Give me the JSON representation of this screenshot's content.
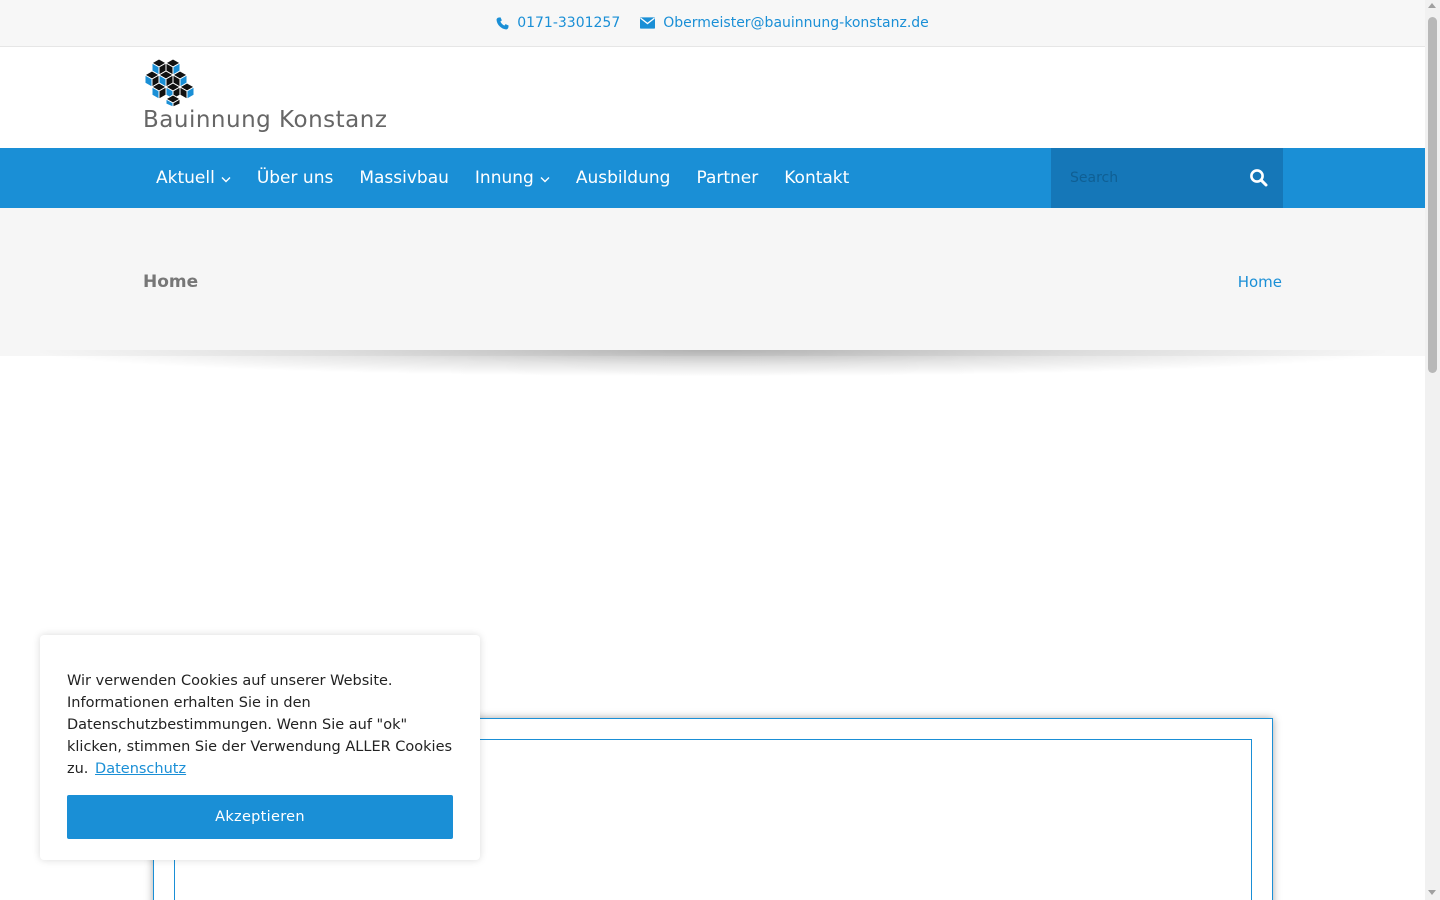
{
  "topbar": {
    "phone": "0171-3301257",
    "phone_icon": "phone-icon",
    "email": "Obermeister@bauinnung-konstanz.de",
    "email_icon": "envelope-icon"
  },
  "header": {
    "logo_icon": "cubes-logo",
    "site_title": "Bauinnung Konstanz"
  },
  "nav": {
    "items": [
      {
        "label": "Aktuell",
        "has_dropdown": true
      },
      {
        "label": "Über uns",
        "has_dropdown": false
      },
      {
        "label": "Massivbau",
        "has_dropdown": false
      },
      {
        "label": "Innung",
        "has_dropdown": true
      },
      {
        "label": "Ausbildung",
        "has_dropdown": false
      },
      {
        "label": "Partner",
        "has_dropdown": false
      },
      {
        "label": "Kontakt",
        "has_dropdown": false
      }
    ],
    "search_placeholder": "Search",
    "search_icon": "search-icon"
  },
  "page_header": {
    "title": "Home",
    "breadcrumb": "Home"
  },
  "cookie": {
    "text": "Wir verwenden Cookies auf unserer Website. Informationen erhalten Sie in den Datenschutzbestimmungen. Wenn Sie auf \"ok\" klicken, stimmen Sie der Verwendung ALLER Cookies zu.",
    "link": "Datenschutz",
    "button": "Akzeptieren"
  },
  "colors": {
    "brand_blue": "#1a8fd6",
    "search_bg": "#1577b8",
    "band_bg": "#f6f6f6"
  }
}
